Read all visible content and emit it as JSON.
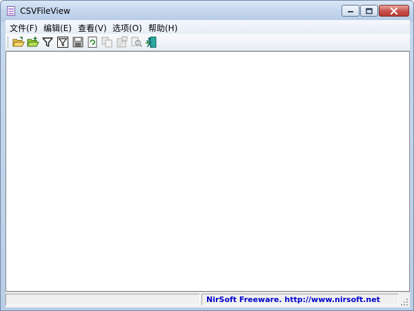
{
  "window": {
    "title": "CSVFileView",
    "icon": "csv-file-icon",
    "controls": [
      "minimize-icon",
      "maximize-icon",
      "close-icon"
    ]
  },
  "menu": {
    "file": "文件(F)",
    "edit": "编辑(E)",
    "view": "查看(V)",
    "options": "选项(O)",
    "help": "帮助(H)"
  },
  "toolbar": {
    "icons": [
      "open-folder-icon",
      "open-folder-add-icon",
      "filter-icon",
      "filter-box-icon",
      "save-icon",
      "refresh-icon",
      "copy-icon",
      "properties-icon",
      "find-icon",
      "exit-icon"
    ]
  },
  "content": {
    "rows": []
  },
  "status": {
    "pane1_text": "",
    "link_text": "NirSoft Freeware.  http://www.nirsoft.net",
    "link_color": "#0000cc"
  }
}
